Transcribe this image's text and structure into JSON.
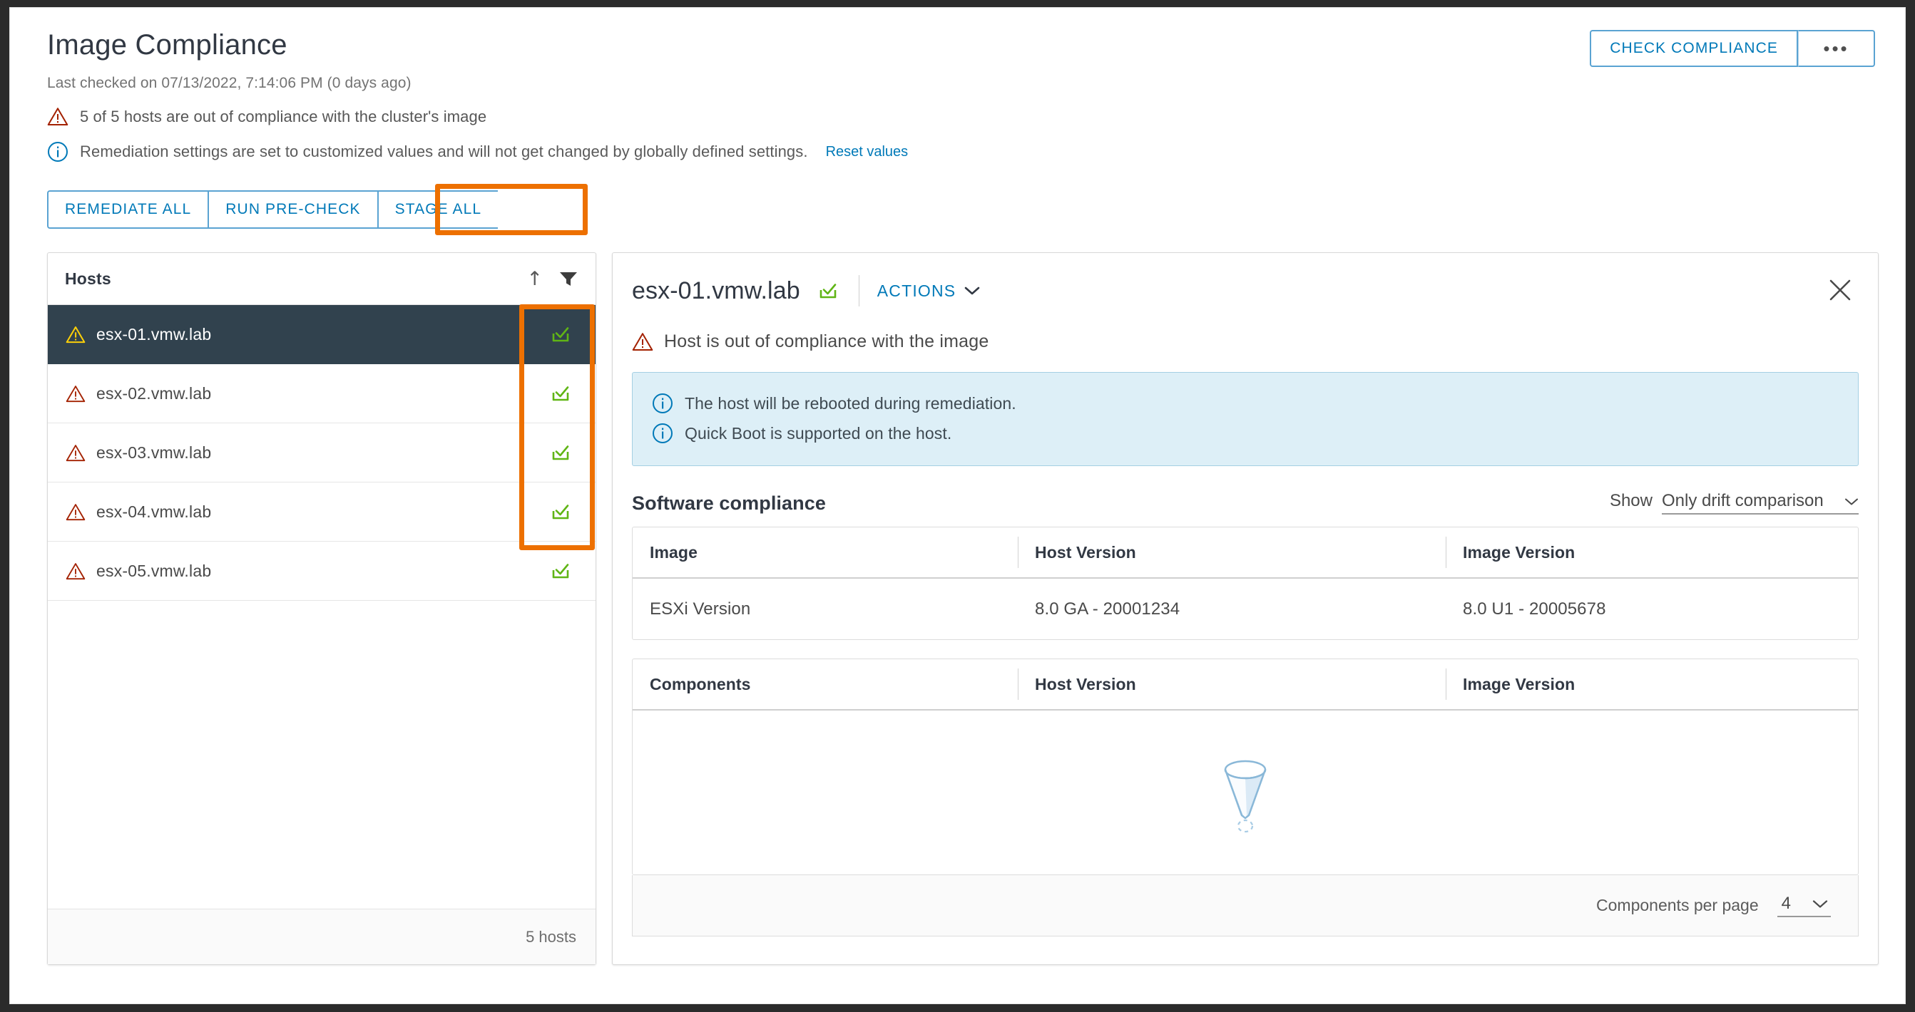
{
  "header": {
    "title": "Image Compliance",
    "last_checked": "Last checked on 07/13/2022, 7:14:06 PM (0 days ago)",
    "warning_message": "5 of 5 hosts are out of compliance with the cluster's image",
    "info_message": "Remediation settings are set to customized values and will not get changed by globally defined settings.",
    "reset_link": "Reset values",
    "check_compliance_label": "CHECK COMPLIANCE",
    "more_label": "•••"
  },
  "toolbar": {
    "remediate_all": "REMEDIATE ALL",
    "run_precheck": "RUN PRE-CHECK",
    "stage_all": "STAGE ALL"
  },
  "hosts_panel": {
    "column_header": "Hosts",
    "footer_count": "5 hosts",
    "rows": [
      {
        "name": "esx-01.vmw.lab",
        "selected": true
      },
      {
        "name": "esx-02.vmw.lab",
        "selected": false
      },
      {
        "name": "esx-03.vmw.lab",
        "selected": false
      },
      {
        "name": "esx-04.vmw.lab",
        "selected": false
      },
      {
        "name": "esx-05.vmw.lab",
        "selected": false
      }
    ]
  },
  "detail": {
    "host_name": "esx-01.vmw.lab",
    "actions_label": "ACTIONS",
    "compliance_status": "Host is out of compliance with the image",
    "alerts": [
      "The host will be rebooted during remediation.",
      "Quick Boot is supported on the host."
    ],
    "software_compliance_title": "Software compliance",
    "show_label": "Show",
    "show_value": "Only drift comparison",
    "image_table": {
      "headers": [
        "Image",
        "Host Version",
        "Image Version"
      ],
      "rows": [
        [
          "ESXi Version",
          "8.0 GA - 20001234",
          "8.0 U1 - 20005678"
        ]
      ]
    },
    "components_table": {
      "headers": [
        "Components",
        "Host Version",
        "Image Version"
      ],
      "rows": []
    },
    "per_page_label": "Components per page",
    "per_page_value": "4"
  },
  "colors": {
    "accent_blue": "#0079b8",
    "highlight_orange": "#ED7000",
    "selected_row": "#31424e",
    "stage_green": "#60B515",
    "warning_red": "#A32100",
    "warning_yellow": "#FDD008",
    "info_blue": "#0079b8"
  }
}
